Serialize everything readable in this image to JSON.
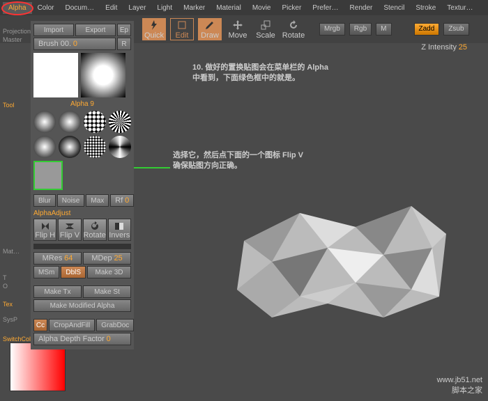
{
  "menu": {
    "items": [
      "Alpha",
      "Color",
      "Docum…",
      "Edit",
      "Layer",
      "Light",
      "Marker",
      "Material",
      "Movie",
      "Picker",
      "Prefer…",
      "Render",
      "Stencil",
      "Stroke",
      "Textur…"
    ]
  },
  "panel": {
    "import": "Import",
    "export": "Export",
    "ep": "Ep",
    "brush_label": "Brush 00.",
    "brush_val": "0",
    "r": "R",
    "alpha_label": "Alpha 9",
    "blur": "Blur",
    "noise": "Noise",
    "max": "Max",
    "rf": "Rf",
    "rf_val": "0",
    "adjust": "AlphaAdjust",
    "fliph": "Flip H",
    "flipv": "Flip V",
    "rotate": "Rotate",
    "invers": "Invers",
    "mres": "MRes",
    "mres_val": "64",
    "mdep": "MDep",
    "mdep_val": "25",
    "msm": "MSm",
    "dbls": "DblS",
    "make3d": "Make 3D",
    "maketx": "Make Tx",
    "makest": "Make St",
    "makemod": "Make Modified Alpha",
    "cc": "Cc",
    "crop": "CropAndFill",
    "grab": "GrabDoc",
    "depth": "Alpha Depth Factor",
    "depth_val": "0"
  },
  "side": {
    "proj": "Projection",
    "mast": "Master",
    "tool": "Tool",
    "mat": "Mat…",
    "t": "T",
    "o": "O",
    "tex": "Tex",
    "sysp": "SysP",
    "switch": "SwitchColor"
  },
  "tools": {
    "quick": "Quick",
    "edit": "Edit",
    "draw": "Draw",
    "move": "Move",
    "scale": "Scale",
    "rotate": "Rotate"
  },
  "top": {
    "mrgb": "Mrgb",
    "rgb": "Rgb",
    "m": "M",
    "zadd": "Zadd",
    "zsub": "Zsub",
    "zint": "Z Intensity",
    "zint_val": "25"
  },
  "anno": {
    "line1": "10.  做好的置换贴图会在菜单栏的 Alpha",
    "line2": "中看到，下面绿色框中的就是。",
    "line3": "选择它，然后点下面的一个图标 Flip V",
    "line4": "确保贴图方向正确。"
  },
  "watermark": {
    "url": "www.jb51.net",
    "name": "脚本之家"
  }
}
